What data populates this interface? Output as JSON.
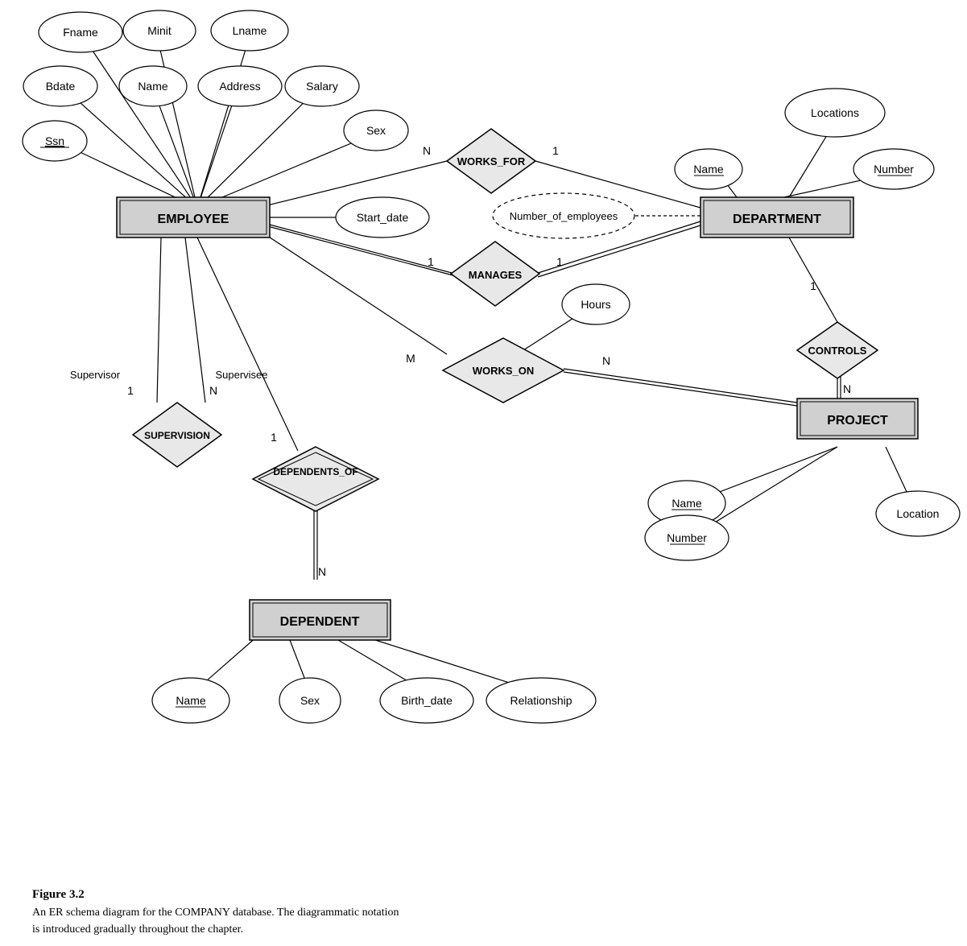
{
  "caption": {
    "title": "Figure 3.2",
    "line1": "An ER schema diagram for the COMPANY database. The diagrammatic notation",
    "line2": "is introduced gradually throughout the chapter."
  },
  "entities": {
    "employee": "EMPLOYEE",
    "department": "DEPARTMENT",
    "project": "PROJECT",
    "dependent": "DEPENDENT"
  },
  "relationships": {
    "works_for": "WORKS_FOR",
    "manages": "MANAGES",
    "supervision": "SUPERVISION",
    "works_on": "WORKS_ON",
    "controls": "CONTROLS",
    "dependents_of": "DEPENDENTS_OF"
  },
  "attributes": {
    "fname": "Fname",
    "minit": "Minit",
    "lname": "Lname",
    "bdate": "Bdate",
    "name_emp": "Name",
    "address": "Address",
    "salary": "Salary",
    "ssn": "Ssn",
    "sex_emp": "Sex",
    "start_date": "Start_date",
    "number_of_employees": "Number_of_employees",
    "locations": "Locations",
    "dept_name": "Name",
    "dept_number": "Number",
    "hours": "Hours",
    "proj_name": "Name",
    "proj_number": "Number",
    "location": "Location",
    "dep_name": "Name",
    "dep_sex": "Sex",
    "birth_date": "Birth_date",
    "relationship": "Relationship"
  },
  "cardinalities": {
    "n1": "N",
    "n2": "1",
    "n3": "1",
    "n4": "1",
    "n5": "M",
    "n6": "N",
    "n7": "N",
    "n8": "1",
    "n9": "1",
    "n10": "N",
    "n11": "N",
    "n12": "1"
  }
}
